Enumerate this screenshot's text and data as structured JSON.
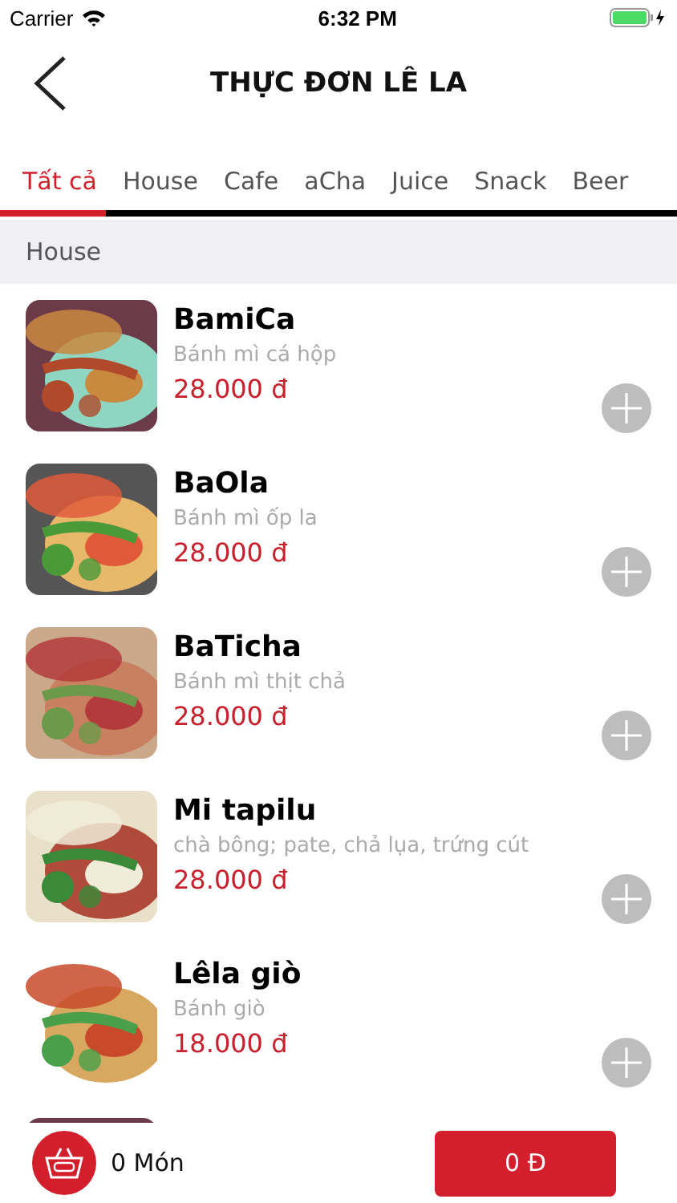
{
  "status_bar": {
    "carrier": "Carrier",
    "time": "6:32 PM"
  },
  "nav": {
    "title": "THỰC ĐƠN LÊ LA"
  },
  "tabs": [
    {
      "label": "Tất cả",
      "selected": true
    },
    {
      "label": "House",
      "selected": false
    },
    {
      "label": "Cafe",
      "selected": false
    },
    {
      "label": "aCha",
      "selected": false
    },
    {
      "label": "Juice",
      "selected": false
    },
    {
      "label": "Snack",
      "selected": false
    },
    {
      "label": "Beer",
      "selected": false
    }
  ],
  "section": {
    "title": "House"
  },
  "items": [
    {
      "name": "BamiCa",
      "description": "Bánh mì cá hộp",
      "price": "28.000 đ"
    },
    {
      "name": "BaOla",
      "description": "Bánh mì ốp la",
      "price": "28.000 đ"
    },
    {
      "name": "BaTicha",
      "description": "Bánh mì thịt chả",
      "price": "28.000 đ"
    },
    {
      "name": "Mi tapilu",
      "description": "chà bông; pate, chả lụa, trứng cút",
      "price": "28.000 đ"
    },
    {
      "name": "Lêla giò",
      "description": "Bánh giò",
      "price": "18.000 đ"
    }
  ],
  "cart": {
    "count": "0 Món",
    "total": "0 Đ"
  }
}
